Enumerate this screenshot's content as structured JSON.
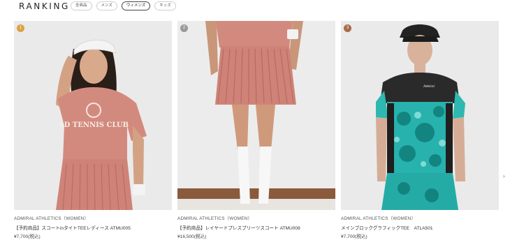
{
  "header": {
    "title": "RANKING",
    "tabs": [
      {
        "label": "全商品",
        "active": false
      },
      {
        "label": "メンズ",
        "active": false
      },
      {
        "label": "ウィメンズ",
        "active": true
      },
      {
        "label": "キッズ",
        "active": false
      }
    ]
  },
  "products": [
    {
      "rank": "1",
      "rank_color": "#d9a441",
      "brand": "ADMIRAL ATHLETICS（WOMEN）",
      "name": "【予約商品】スコートinタイトTEEレディース ATMU005",
      "price": "¥7,700(税込)",
      "shirt_print": "AD TENNIS CLUB"
    },
    {
      "rank": "2",
      "rank_color": "#9a9a9a",
      "brand": "ADMIRAL ATHLETICS（WOMEN）",
      "name": "【予約商品】レイヤードプレスプリーツスコート ATMU008",
      "price": "¥16,500(税込)"
    },
    {
      "rank": "3",
      "rank_color": "#a86b4a",
      "brand": "ADMIRAL ATHLETICS（WOMEN）",
      "name": "メインブロックグラフィックTEE　ATLA501",
      "price": "¥7,700(税込)",
      "shirt_print": "Admiral"
    }
  ],
  "carousel": {
    "next_glyph": "›"
  }
}
